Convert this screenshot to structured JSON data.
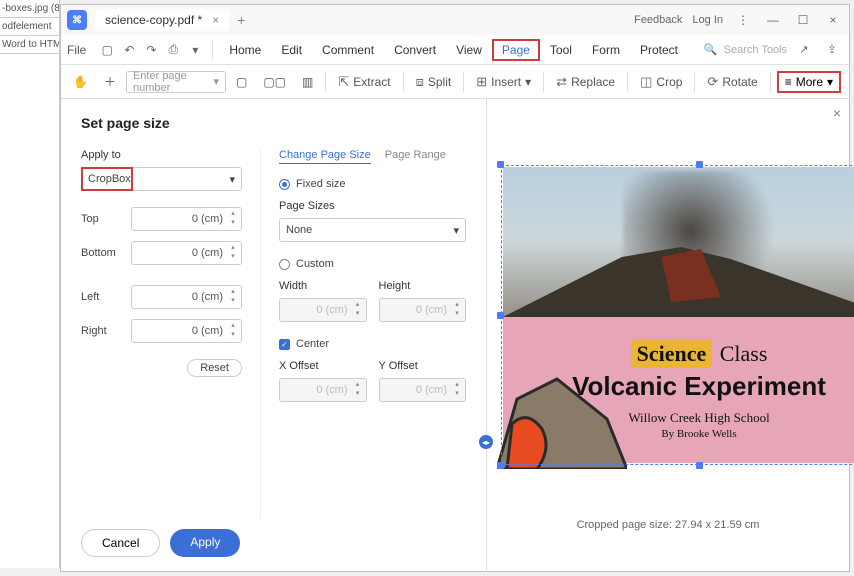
{
  "left_tabs": [
    "-boxes.jpg (8",
    "odfelement",
    "Word to HTM"
  ],
  "titlebar": {
    "file_name": "science-copy.pdf *",
    "feedback": "Feedback",
    "login": "Log In"
  },
  "menubar": {
    "file": "File",
    "items": [
      "Home",
      "Edit",
      "Comment",
      "Convert",
      "View",
      "Page",
      "Tool",
      "Form",
      "Protect"
    ],
    "search": "Search Tools"
  },
  "toolbar": {
    "page_placeholder": "Enter page number",
    "extract": "Extract",
    "split": "Split",
    "insert": "Insert",
    "replace": "Replace",
    "crop": "Crop",
    "rotate": "Rotate",
    "more": "More"
  },
  "panel": {
    "title": "Set page size",
    "apply_to": "Apply to",
    "apply_value": "CropBox",
    "top": "Top",
    "bottom": "Bottom",
    "left": "Left",
    "right": "Right",
    "zero": "0 (cm)",
    "reset": "Reset",
    "tabs": {
      "change": "Change Page Size",
      "range": "Page Range"
    },
    "fixed": "Fixed size",
    "page_sizes": "Page Sizes",
    "none": "None",
    "custom": "Custom",
    "width": "Width",
    "height": "Height",
    "center": "Center",
    "xoff": "X Offset",
    "yoff": "Y Offset",
    "cancel": "Cancel",
    "apply": "Apply"
  },
  "document": {
    "tag": "Science",
    "cls": " Class",
    "title": "Volcanic Experiment",
    "school": "Willow Creek High School",
    "author": "By Brooke Wells"
  },
  "footer": "Cropped page size: 27.94 x 21.59 cm"
}
